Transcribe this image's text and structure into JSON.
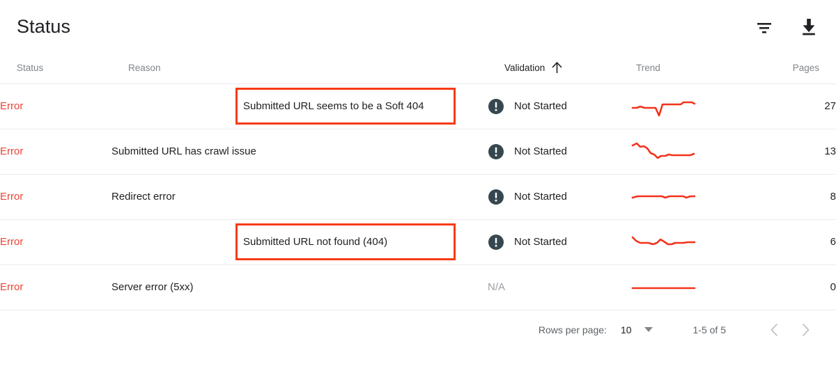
{
  "header": {
    "title": "Status",
    "actions": [
      {
        "name": "filter-icon",
        "label": "Filter"
      },
      {
        "name": "download-icon",
        "label": "Download"
      }
    ]
  },
  "table": {
    "columns": [
      {
        "key": "status",
        "label": "Status",
        "sorted": false
      },
      {
        "key": "reason",
        "label": "Reason",
        "sorted": false
      },
      {
        "key": "validation",
        "label": "Validation",
        "sorted": true,
        "sort_direction": "asc",
        "sort_icon": "arrow-up-icon"
      },
      {
        "key": "trend",
        "label": "Trend",
        "sorted": false
      },
      {
        "key": "pages",
        "label": "Pages",
        "sorted": false
      }
    ],
    "rows": [
      {
        "status": "Error",
        "reason": "Submitted URL seems to be a Soft 404",
        "highlighted": true,
        "validation": "Not Started",
        "validation_icon": "exclamation-circle-icon",
        "pages": "27"
      },
      {
        "status": "Error",
        "reason": "Submitted URL has crawl issue",
        "highlighted": false,
        "validation": "Not Started",
        "validation_icon": "exclamation-circle-icon",
        "pages": "13"
      },
      {
        "status": "Error",
        "reason": "Redirect error",
        "highlighted": false,
        "validation": "Not Started",
        "validation_icon": "exclamation-circle-icon",
        "pages": "8"
      },
      {
        "status": "Error",
        "reason": "Submitted URL not found (404)",
        "highlighted": true,
        "validation": "Not Started",
        "validation_icon": "exclamation-circle-icon",
        "pages": "6"
      },
      {
        "status": "Error",
        "reason": "Server error (5xx)",
        "highlighted": false,
        "validation": "N/A",
        "validation_icon": null,
        "pages": "0"
      }
    ]
  },
  "footer": {
    "rows_per_page_label": "Rows per page:",
    "rows_per_page_value": "10",
    "range_label": "1-5 of 5",
    "prev_icon": "chevron-left-icon",
    "next_icon": "chevron-right-icon"
  },
  "colors": {
    "error_red": "#ea4335",
    "highlight_red": "#f93a15",
    "sparkline_red": "#f4321c",
    "severity_icon": "#37474f",
    "muted_text": "#80868b",
    "primary_text": "#202124",
    "row_divider": "#ececec"
  },
  "chart_data": [
    {
      "type": "line",
      "title": "Trend - Submitted URL seems to be a Soft 404",
      "x": [
        0,
        1,
        2,
        3,
        4,
        5,
        6,
        7,
        8,
        9,
        10,
        11,
        12,
        13,
        14,
        15,
        16,
        17,
        18
      ],
      "values": [
        6,
        6,
        7,
        6,
        6,
        6,
        6,
        2,
        8,
        8,
        8,
        8,
        8,
        8,
        8,
        11,
        11,
        11,
        10
      ],
      "ylim": [
        0,
        14
      ],
      "grid": false
    },
    {
      "type": "line",
      "title": "Trend - Submitted URL has crawl issue",
      "x": [
        0,
        1,
        2,
        3,
        4,
        5,
        6,
        7,
        8,
        9,
        10,
        11,
        12,
        13,
        14,
        15,
        16,
        17,
        18
      ],
      "values": [
        13,
        14,
        12,
        12,
        11,
        8,
        7,
        4,
        3,
        5,
        5,
        6,
        6,
        5,
        5,
        5,
        5,
        5,
        6
      ],
      "ylim": [
        0,
        16
      ],
      "grid": false
    },
    {
      "type": "line",
      "title": "Trend - Redirect error",
      "x": [
        0,
        1,
        2,
        3,
        4,
        5,
        6,
        7,
        8,
        9,
        10,
        11,
        12,
        13,
        14,
        15,
        16,
        17,
        18
      ],
      "values": [
        5,
        6,
        6,
        6,
        6,
        6,
        6,
        6,
        6,
        5,
        6,
        6,
        6,
        6,
        6,
        6,
        6,
        5,
        6
      ],
      "ylim": [
        0,
        10
      ],
      "grid": false
    },
    {
      "type": "line",
      "title": "Trend - Submitted URL not found (404)",
      "x": [
        0,
        1,
        2,
        3,
        4,
        5,
        6,
        7,
        8,
        9,
        10,
        11,
        12,
        13,
        14,
        15,
        16,
        17,
        18
      ],
      "values": [
        10,
        8,
        7,
        7,
        7,
        7,
        6,
        7,
        9,
        8,
        7,
        6,
        6,
        7,
        7,
        7,
        7,
        7,
        7
      ],
      "ylim": [
        0,
        12
      ],
      "grid": false
    },
    {
      "type": "line",
      "title": "Trend - Server error (5xx)",
      "x": [
        0,
        1,
        2,
        3,
        4,
        5,
        6,
        7,
        8,
        9,
        10,
        11,
        12,
        13,
        14,
        15,
        16,
        17,
        18
      ],
      "values": [
        0,
        0,
        0,
        0,
        0,
        0,
        0,
        0,
        0,
        0,
        0,
        0,
        0,
        0,
        0,
        0,
        0,
        0,
        0
      ],
      "ylim": [
        0,
        10
      ],
      "grid": false
    }
  ]
}
